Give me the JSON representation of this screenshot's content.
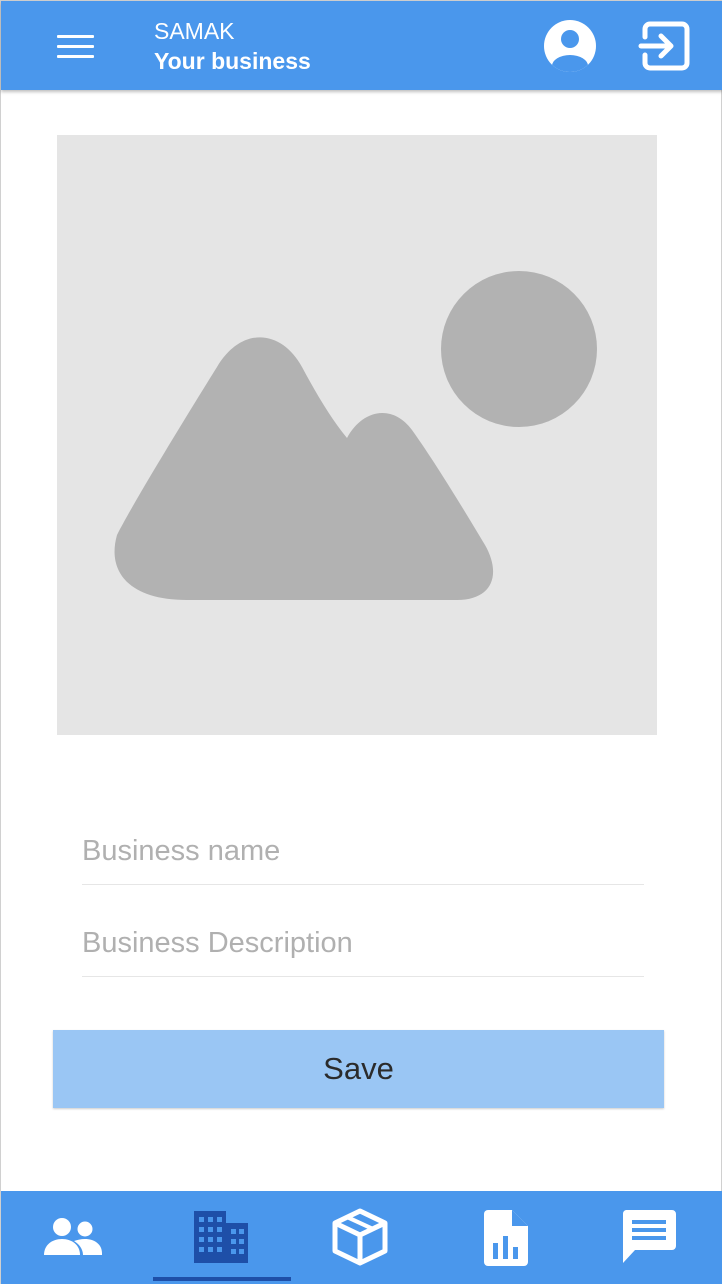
{
  "header": {
    "app_name": "SAMAK",
    "page_title": "Your business",
    "menu_icon": "menu-icon",
    "account_icon": "account-circle-icon",
    "logout_icon": "logout-icon"
  },
  "image_upload": {
    "icon": "image-placeholder-icon"
  },
  "form": {
    "name_placeholder": "Business name",
    "name_value": "",
    "description_placeholder": "Business Description",
    "description_value": "",
    "save_label": "Save"
  },
  "bottom_nav": {
    "items": [
      {
        "id": "people",
        "icon": "people-icon",
        "active": false
      },
      {
        "id": "business",
        "icon": "building-icon",
        "active": true
      },
      {
        "id": "products",
        "icon": "package-icon",
        "active": false
      },
      {
        "id": "reports",
        "icon": "report-chart-icon",
        "active": false
      },
      {
        "id": "messages",
        "icon": "message-icon",
        "active": false
      }
    ]
  },
  "colors": {
    "primary": "#4a97ec",
    "button": "#9ac6f4",
    "active_indicator": "#1e4fa8",
    "active_icon": "#1e4fa8",
    "placeholder_bg": "#e5e5e5",
    "placeholder_shape": "#b2b2b2"
  }
}
